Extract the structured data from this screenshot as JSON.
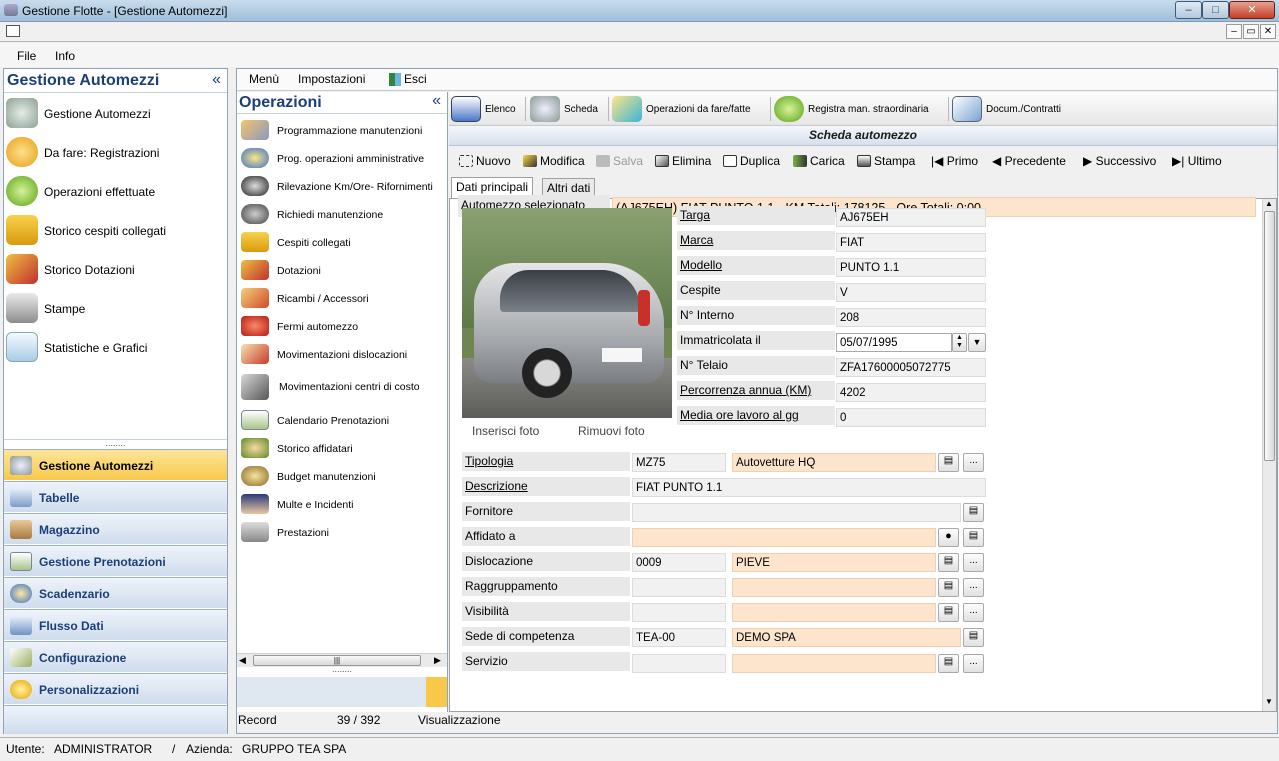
{
  "window": {
    "title": "Gestione Flotte - [Gestione Automezzi]",
    "min": "–",
    "max": "□",
    "close": "✕"
  },
  "mdi": {
    "min": "–",
    "restore": "▭",
    "close": "✕"
  },
  "menubar": {
    "file": "File",
    "info": "Info"
  },
  "leftpanel": {
    "title": "Gestione Automezzi",
    "collapse": "«",
    "grip": "........",
    "items": [
      {
        "label": "Gestione Automezzi",
        "icon": "car-icon"
      },
      {
        "label": "Da fare: Registrazioni",
        "icon": "question-icon"
      },
      {
        "label": "Operazioni effettuate",
        "icon": "checkmark-icon"
      },
      {
        "label": "Storico cespiti collegati",
        "icon": "truck-icon"
      },
      {
        "label": "Storico Dotazioni",
        "icon": "tools-icon"
      },
      {
        "label": "Stampe",
        "icon": "printer-icon"
      },
      {
        "label": "Statistiche e Grafici",
        "icon": "chart-icon"
      }
    ],
    "nav": [
      {
        "label": "Gestione Automezzi",
        "icon": "car-icon",
        "selected": true
      },
      {
        "label": "Tabelle",
        "icon": "table-icon"
      },
      {
        "label": "Magazzino",
        "icon": "box-icon"
      },
      {
        "label": "Gestione Prenotazioni",
        "icon": "calendar-icon"
      },
      {
        "label": "Scadenzario",
        "icon": "clock-icon"
      },
      {
        "label": "Flusso Dati",
        "icon": "data-icon"
      },
      {
        "label": "Configurazione",
        "icon": "config-icon"
      },
      {
        "label": "Personalizzazioni",
        "icon": "star-icon"
      }
    ]
  },
  "contentmenu": {
    "menu": "Menù",
    "settings": "Impostazioni",
    "exit": "Esci"
  },
  "ops": {
    "title": "Operazioni",
    "collapse": "«",
    "scroll_thumb": "|||",
    "grip": "........",
    "items": [
      "Programmazione manutenzioni",
      "Prog. operazioni amministrative",
      "Rilevazione Km/Ore- Rifornimenti",
      "Richiedi manutenzione",
      "Cespiti collegati",
      "Dotazioni",
      "Ricambi / Accessori",
      "Fermi automezzo",
      "Movimentazioni dislocazioni",
      "Movimentazioni centri di costo",
      "Calendario Prenotazioni",
      "Storico affidatari",
      "Budget manutenzioni",
      "Multe e Incidenti",
      "Prestazioni"
    ]
  },
  "toolbar1": {
    "elenco": "Elenco",
    "scheda": "Scheda",
    "operazioni": "Operazioni da fare/fatte",
    "registra": "Registra man. straordinaria",
    "docum": "Docum./Contratti"
  },
  "scheda_title": "Scheda automezzo",
  "toolbar2": {
    "nuovo": "Nuovo",
    "modifica": "Modifica",
    "salva": "Salva",
    "elimina": "Elimina",
    "duplica": "Duplica",
    "carica": "Carica",
    "stampa": "Stampa",
    "primo": "Primo",
    "precedente": "Precedente",
    "successivo": "Successivo",
    "ultimo": "Ultimo"
  },
  "tabs": {
    "main": "Dati principali",
    "other": "Altri dati"
  },
  "form": {
    "selected_label": "Automezzo selezionato",
    "selected_value": "(AJ675EH) FIAT PUNTO 1.1 - KM Totali: 178125 - Ore Totali: 0:00",
    "targa_l": "Targa",
    "targa": "AJ675EH",
    "marca_l": "Marca",
    "marca": "FIAT",
    "modello_l": "Modello",
    "modello": "PUNTO 1.1",
    "cespite_l": "Cespite",
    "cespite": "V",
    "interno_l": "N° Interno",
    "interno": "208",
    "immatr_l": "Immatricolata il",
    "immatr": "05/07/1995",
    "telaio_l": "N° Telaio",
    "telaio": "ZFA17600005072775",
    "percorrenza_l": "Percorrenza annua (KM)",
    "percorrenza": "4202",
    "mediaore_l": "Media ore lavoro al gg",
    "mediaore": "0",
    "inserisci_foto": "Inserisci foto",
    "rimuovi_foto": "Rimuovi foto",
    "tipologia_l": "Tipologia",
    "tipologia_code": "MZ75",
    "tipologia_desc": "Autovetture HQ",
    "descrizione_l": "Descrizione",
    "descrizione": "FIAT PUNTO 1.1",
    "fornitore_l": "Fornitore",
    "fornitore": "",
    "affidato_l": "Affidato a",
    "affidato": "",
    "dislocazione_l": "Dislocazione",
    "dislocazione_code": "0009",
    "dislocazione_desc": "PIEVE",
    "raggruppamento_l": "Raggruppamento",
    "raggruppamento_code": "",
    "raggruppamento_desc": "",
    "visibilita_l": "Visibilità",
    "visibilita_code": "",
    "visibilita_desc": "",
    "sede_l": "Sede di competenza",
    "sede_code": "TEA-00",
    "sede_desc": "DEMO SPA",
    "servizio_l": "Servizio",
    "servizio_code": "",
    "servizio_desc": "",
    "lookup_btn": "▤",
    "more_btn": "..."
  },
  "record": {
    "label": "Record",
    "pos": "39 / 392",
    "mode": "Visualizzazione"
  },
  "statusbar": {
    "user_label": "Utente:",
    "user": "ADMINISTRATOR",
    "sep": "/",
    "company_label": "Azienda:",
    "company": "GRUPPO TEA SPA"
  },
  "colors": {
    "accent": "#1c3f79",
    "highlight": "#fde4cc",
    "nav_selected": "#f8c84a"
  }
}
